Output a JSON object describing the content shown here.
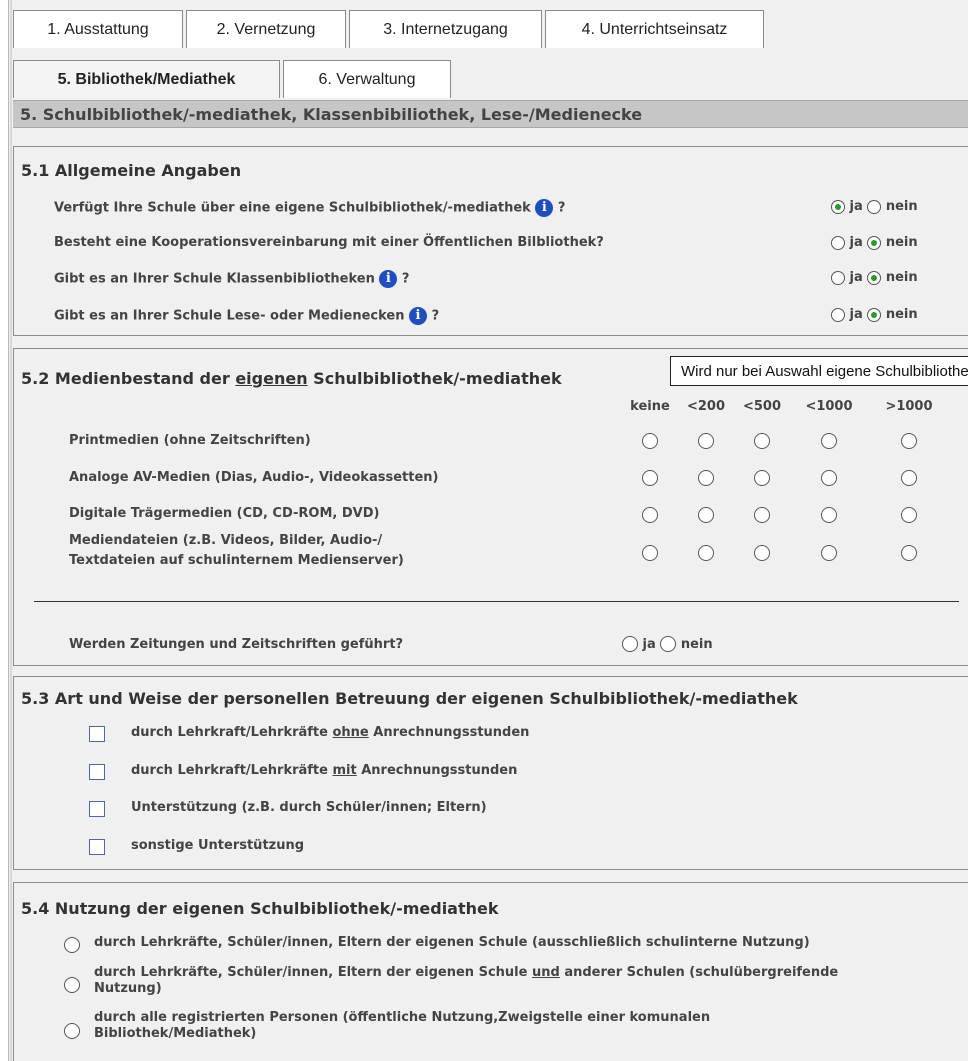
{
  "tabs_row1": [
    "1. Ausstattung",
    "2. Vernetzung",
    "3. Internetzugang",
    "4. Unterrichtseinsatz"
  ],
  "tabs_row2": [
    "5. Bibliothek/Mediathek",
    "6. Verwaltung"
  ],
  "section_header": "5. Schulbibliothek/-mediathek, Klassenbibiliothek, Lese-/Medienecke",
  "s51": {
    "title": "5.1 Allgemeine Angaben",
    "yes": "ja",
    "no": "nein",
    "questions": [
      {
        "text": "Verfügt Ihre Schule über eine eigene Schulbibliothek/-mediathek",
        "suffix": "?",
        "info": true,
        "selected": "ja"
      },
      {
        "text": "Besteht eine Kooperationsvereinbarung mit einer Öffentlichen Bilbliothek?",
        "suffix": "",
        "info": false,
        "selected": "nein"
      },
      {
        "text": "Gibt es an Ihrer Schule Klassenbibliotheken",
        "suffix": "?",
        "info": true,
        "selected": "nein"
      },
      {
        "text": "Gibt es an Ihrer Schule Lese- oder Medienecken",
        "suffix": "?",
        "info": true,
        "selected": "nein"
      }
    ]
  },
  "tooltip": "Wird nur bei Auswahl eigene Schulbibliothek",
  "s52": {
    "title_pre": "5.2 Medienbestand der ",
    "title_u": "eigenen",
    "title_post": " Schulbibliothek/-mediathek",
    "columns": [
      "keine",
      "<200",
      "<500",
      "<1000",
      ">1000"
    ],
    "rows": [
      "Printmedien (ohne Zeitschriften)",
      "Analoge AV-Medien (Dias, Audio-, Videokassetten)",
      "Digitale Trägermedien (CD, CD-ROM, DVD)",
      "Mediendateien (z.B. Videos, Bilder, Audio-/",
      "Textdateien auf schulinternem Medienserver)"
    ],
    "newspaper_q": "Werden Zeitungen und Zeitschriften geführt?",
    "yes": "ja",
    "no": "nein"
  },
  "s53": {
    "title": "5.3 Art und Weise der personellen Betreuung der eigenen Schulbibliothek/-mediathek",
    "opt1_pre": "durch Lehrkraft/Lehrkräfte ",
    "opt1_u": "ohne",
    "opt1_post": " Anrechnungsstunden",
    "opt2_pre": "durch Lehrkraft/Lehrkräfte ",
    "opt2_u": "mit",
    "opt2_post": " Anrechnungsstunden",
    "opt3": "Unterstützung (z.B. durch Schüler/innen; Eltern)",
    "opt4": "sonstige Unterstützung"
  },
  "s54": {
    "title": "5.4 Nutzung der eigenen Schulbibliothek/-mediathek",
    "opt1": "durch Lehrkräfte, Schüler/innen, Eltern der eigenen Schule (ausschließlich schulinterne Nutzung)",
    "opt2_pre": "durch Lehrkräfte, Schüler/innen, Eltern der eigenen Schule ",
    "opt2_u": "und",
    "opt2_post": " anderer Schulen (schulübergreifende",
    "opt2_line2": "Nutzung)",
    "opt3_line1": "durch alle registrierten Personen (öffentliche Nutzung,Zweigstelle einer komunalen",
    "opt3_line2": "Bibliothek/Mediathek)"
  },
  "info_glyph": "i"
}
